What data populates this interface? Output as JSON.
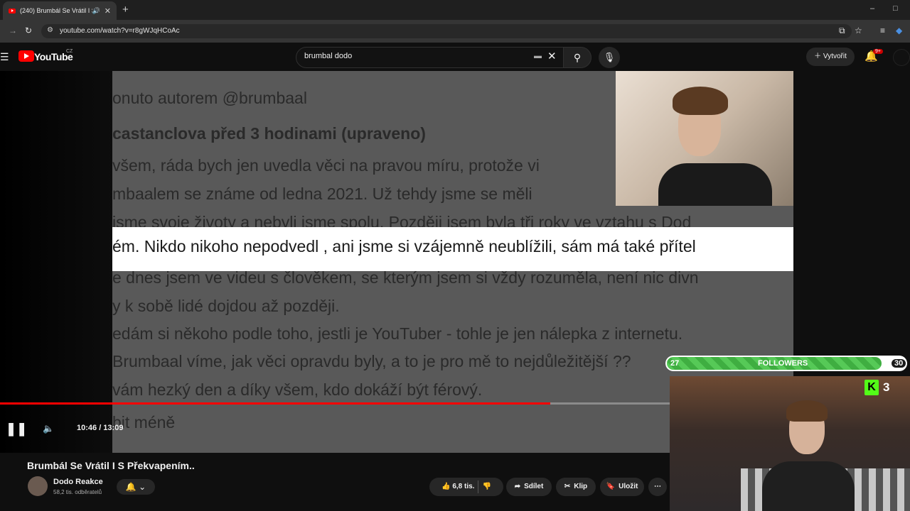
{
  "browser": {
    "tab_title": "(240) Brumbál Se Vrátil I S P",
    "new_tab_icon": "plus-icon",
    "url": "youtube.com/watch?v=r8gWJqHCoAc",
    "minimize": "–",
    "maximize": "□"
  },
  "header": {
    "logo_text": "YouTube",
    "region": "CZ",
    "search_value": "brumbal dodo",
    "create_label": "Vytvořit",
    "notification_count": "9+"
  },
  "video": {
    "comment_lines": [
      "onuto autorem @brumbaal",
      "castanclova  před 3 hodinami (upraveno)",
      "všem, ráda bych jen uvedla věci na pravou míru, protože vi",
      "mbaalem se známe od ledna 2021. Už tehdy jsme se měli",
      "jsme svoje životy a nebyli jsme spolu. Později jsem byla tři roky ve vztahu s Dod",
      "e dnes jsem ve videu s člověkem, se kterým jsem si vždy rozuměla, není nic divn",
      "y k sobě lidé dojdou až později.",
      "edám si někoho podle toho, jestli je YouTuber - tohle je jen nálepka z internetu.",
      "Brumbaal víme, jak věci opravdu byly, a to je pro mě to nejdůležitější ??",
      " vám hezký den a díky všem, kdo dokáží být férový.",
      "bit méně"
    ],
    "highlight_line": "ém. Nikdo nikoho nepodvedl , ani jsme si vzájemně neublížili, sám má také přítel",
    "time_display": "10:46 / 13:09",
    "progress": 0.822
  },
  "info": {
    "title": "Brumbál Se Vrátil I S Překvapením..",
    "channel": "Dodo Reakce",
    "subscribers": "58,2 tis. odběratelů",
    "likes": "6,8 tis.",
    "share": "Sdílet",
    "clip": "Klip",
    "save": "Uložit"
  },
  "overlay": {
    "followers_label": "FOLLOWERS",
    "followers_current": "27",
    "followers_goal": "30",
    "kick_letter": "K",
    "kick_count": "3"
  }
}
